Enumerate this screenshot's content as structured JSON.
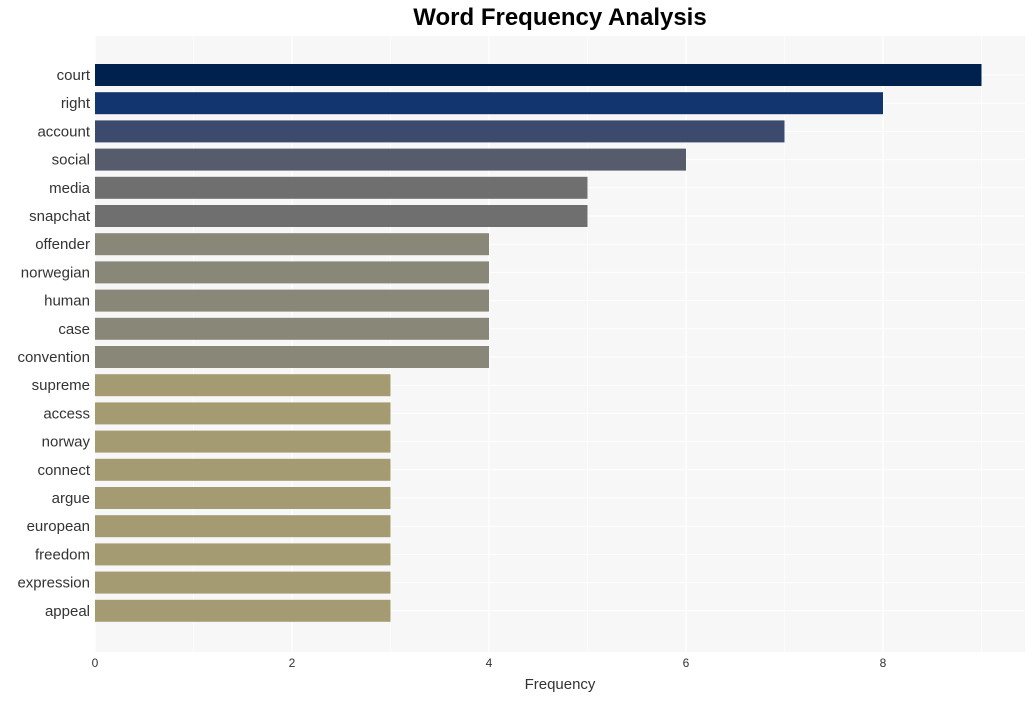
{
  "chart_data": {
    "type": "bar",
    "orientation": "horizontal",
    "title": "Word Frequency Analysis",
    "xlabel": "Frequency",
    "ylabel": "",
    "xlim": [
      0,
      9.45
    ],
    "xticks": [
      0,
      2,
      4,
      6,
      8
    ],
    "grid": true,
    "categories": [
      "court",
      "right",
      "account",
      "social",
      "media",
      "snapchat",
      "offender",
      "norwegian",
      "human",
      "case",
      "convention",
      "supreme",
      "access",
      "norway",
      "connect",
      "argue",
      "european",
      "freedom",
      "expression",
      "appeal"
    ],
    "values": [
      9,
      8,
      7,
      6,
      5,
      5,
      4,
      4,
      4,
      4,
      4,
      3,
      3,
      3,
      3,
      3,
      3,
      3,
      3,
      3
    ],
    "colors": [
      "#00204e",
      "#12346f",
      "#3c4a6e",
      "#575c6d",
      "#6f6f70",
      "#6f6f70",
      "#898778",
      "#898778",
      "#898778",
      "#898778",
      "#898778",
      "#a59b73",
      "#a59b73",
      "#a59b73",
      "#a59b73",
      "#a59b73",
      "#a59b73",
      "#a59b73",
      "#a59b73",
      "#a59b73"
    ],
    "background_color": "#f7f7f7"
  }
}
